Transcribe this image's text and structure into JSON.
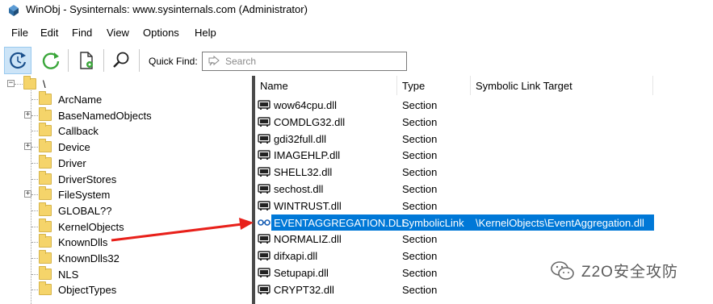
{
  "window": {
    "title": "WinObj - Sysinternals: www.sysinternals.com (Administrator)"
  },
  "menu": [
    {
      "label": "File"
    },
    {
      "label": "Edit"
    },
    {
      "label": "Find"
    },
    {
      "label": "View"
    },
    {
      "label": "Options"
    },
    {
      "label": "Help"
    }
  ],
  "toolbar": {
    "quick_find_label": "Quick Find:",
    "search_placeholder": "Search"
  },
  "tree": {
    "root_label": "\\",
    "items": [
      {
        "label": "ArcName",
        "expandable": false
      },
      {
        "label": "BaseNamedObjects",
        "expandable": true
      },
      {
        "label": "Callback",
        "expandable": false
      },
      {
        "label": "Device",
        "expandable": true
      },
      {
        "label": "Driver",
        "expandable": false
      },
      {
        "label": "DriverStores",
        "expandable": false
      },
      {
        "label": "FileSystem",
        "expandable": true
      },
      {
        "label": "GLOBAL??",
        "expandable": false
      },
      {
        "label": "KernelObjects",
        "expandable": false
      },
      {
        "label": "KnownDlls",
        "expandable": false
      },
      {
        "label": "KnownDlls32",
        "expandable": false
      },
      {
        "label": "NLS",
        "expandable": false
      },
      {
        "label": "ObjectTypes",
        "expandable": false
      }
    ]
  },
  "list": {
    "columns": [
      "Name",
      "Type",
      "Symbolic Link Target"
    ],
    "rows": [
      {
        "name": "wow64cpu.dll",
        "type": "Section",
        "target": "",
        "icon": "section-icon"
      },
      {
        "name": "COMDLG32.dll",
        "type": "Section",
        "target": "",
        "icon": "section-icon"
      },
      {
        "name": "gdi32full.dll",
        "type": "Section",
        "target": "",
        "icon": "section-icon"
      },
      {
        "name": "IMAGEHLP.dll",
        "type": "Section",
        "target": "",
        "icon": "section-icon"
      },
      {
        "name": "SHELL32.dll",
        "type": "Section",
        "target": "",
        "icon": "section-icon"
      },
      {
        "name": "sechost.dll",
        "type": "Section",
        "target": "",
        "icon": "section-icon"
      },
      {
        "name": "WINTRUST.dll",
        "type": "Section",
        "target": "",
        "icon": "section-icon"
      },
      {
        "name": "EVENTAGGREGATION.DLL",
        "type": "SymbolicLink",
        "target": "\\KernelObjects\\EventAggregation.dll",
        "icon": "symlink-icon",
        "selected": true
      },
      {
        "name": "NORMALIZ.dll",
        "type": "Section",
        "target": "",
        "icon": "section-icon"
      },
      {
        "name": "difxapi.dll",
        "type": "Section",
        "target": "",
        "icon": "section-icon"
      },
      {
        "name": "Setupapi.dll",
        "type": "Section",
        "target": "",
        "icon": "section-icon"
      },
      {
        "name": "CRYPT32.dll",
        "type": "Section",
        "target": "",
        "icon": "section-icon"
      }
    ]
  },
  "watermark": {
    "text": "Z2O安全攻防"
  },
  "colors": {
    "selection": "#0078d7",
    "arrow": "#e8201a",
    "folder": "#f5d46a"
  }
}
